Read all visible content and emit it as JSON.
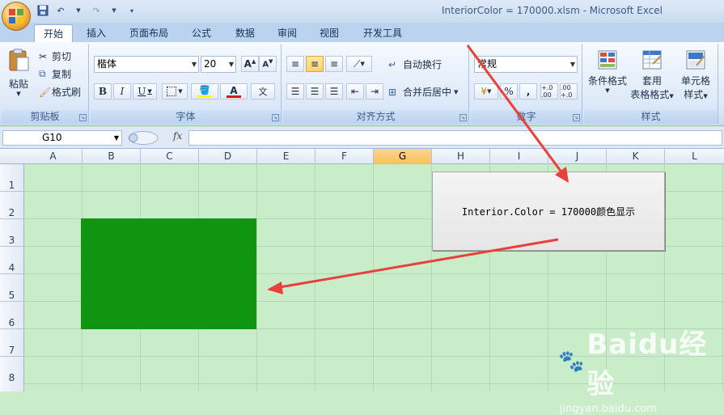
{
  "window": {
    "title": "InteriorColor = 170000.xlsm - Microsoft Excel"
  },
  "quick_access": {
    "undo_icon": "undo-icon",
    "redo_icon": "redo-icon",
    "save_icon": "save-icon"
  },
  "tabs": [
    "开始",
    "插入",
    "页面布局",
    "公式",
    "数据",
    "审阅",
    "视图",
    "开发工具"
  ],
  "active_tab": "开始",
  "clipboard": {
    "paste": "粘贴",
    "cut": "剪切",
    "copy": "复制",
    "format_painter": "格式刷",
    "label": "剪贴板"
  },
  "font": {
    "name": "楷体",
    "size": "20",
    "label": "字体",
    "bold": "B",
    "italic": "I",
    "underline": "U",
    "font_color_letter": "A"
  },
  "alignment": {
    "wrap_text": "自动换行",
    "merge_center": "合并后居中",
    "label": "对齐方式"
  },
  "number": {
    "format": "常规",
    "percent": "%",
    "comma": ",",
    "inc_decimal": "+.0 .00",
    "dec_decimal": ".00 +.0",
    "label": "数字"
  },
  "styles": {
    "conditional_formatting": "条件格式",
    "format_as_table_1": "套用",
    "format_as_table_2": "表格格式",
    "cell_styles_1": "单元格",
    "cell_styles_2": "样式",
    "label": "样式"
  },
  "formula_bar": {
    "name_box": "G10",
    "fx": "fx",
    "content": ""
  },
  "columns": [
    "A",
    "B",
    "C",
    "D",
    "E",
    "F",
    "G",
    "H",
    "I",
    "J",
    "K",
    "L"
  ],
  "selected_column": "G",
  "rows": [
    "1",
    "2",
    "3",
    "4",
    "5",
    "6",
    "7",
    "8"
  ],
  "macro_button": {
    "label": "Interior.Color = 170000颜色显示"
  },
  "fill_color": "#0f950f",
  "sheet_background": "#c9ecc9",
  "annotation_arrow_color": "#e8413b",
  "watermark": {
    "brand": "Baidu经验",
    "url": "jingyan.baidu.com"
  }
}
